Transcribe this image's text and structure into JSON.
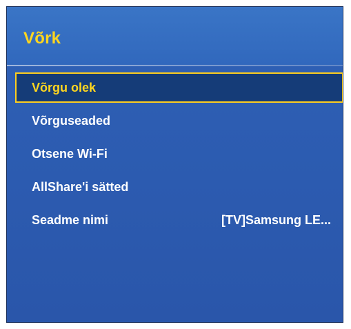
{
  "window": {
    "title": "Võrk"
  },
  "menu": {
    "items": [
      {
        "label": "Võrgu olek",
        "value": "",
        "selected": true
      },
      {
        "label": "Võrguseaded",
        "value": "",
        "selected": false
      },
      {
        "label": "Otsene Wi-Fi",
        "value": "",
        "selected": false
      },
      {
        "label": "AllShare'i sätted",
        "value": "",
        "selected": false
      },
      {
        "label": "Seadme nimi",
        "value": "[TV]Samsung LE...",
        "selected": false
      }
    ]
  },
  "colors": {
    "background": "#2c5bb0",
    "title_band": "#3168bd",
    "highlight_text": "#ffd61f",
    "selected_fill": "#153c78",
    "selected_border": "#ffcf1e",
    "item_text": "#ffffff"
  }
}
